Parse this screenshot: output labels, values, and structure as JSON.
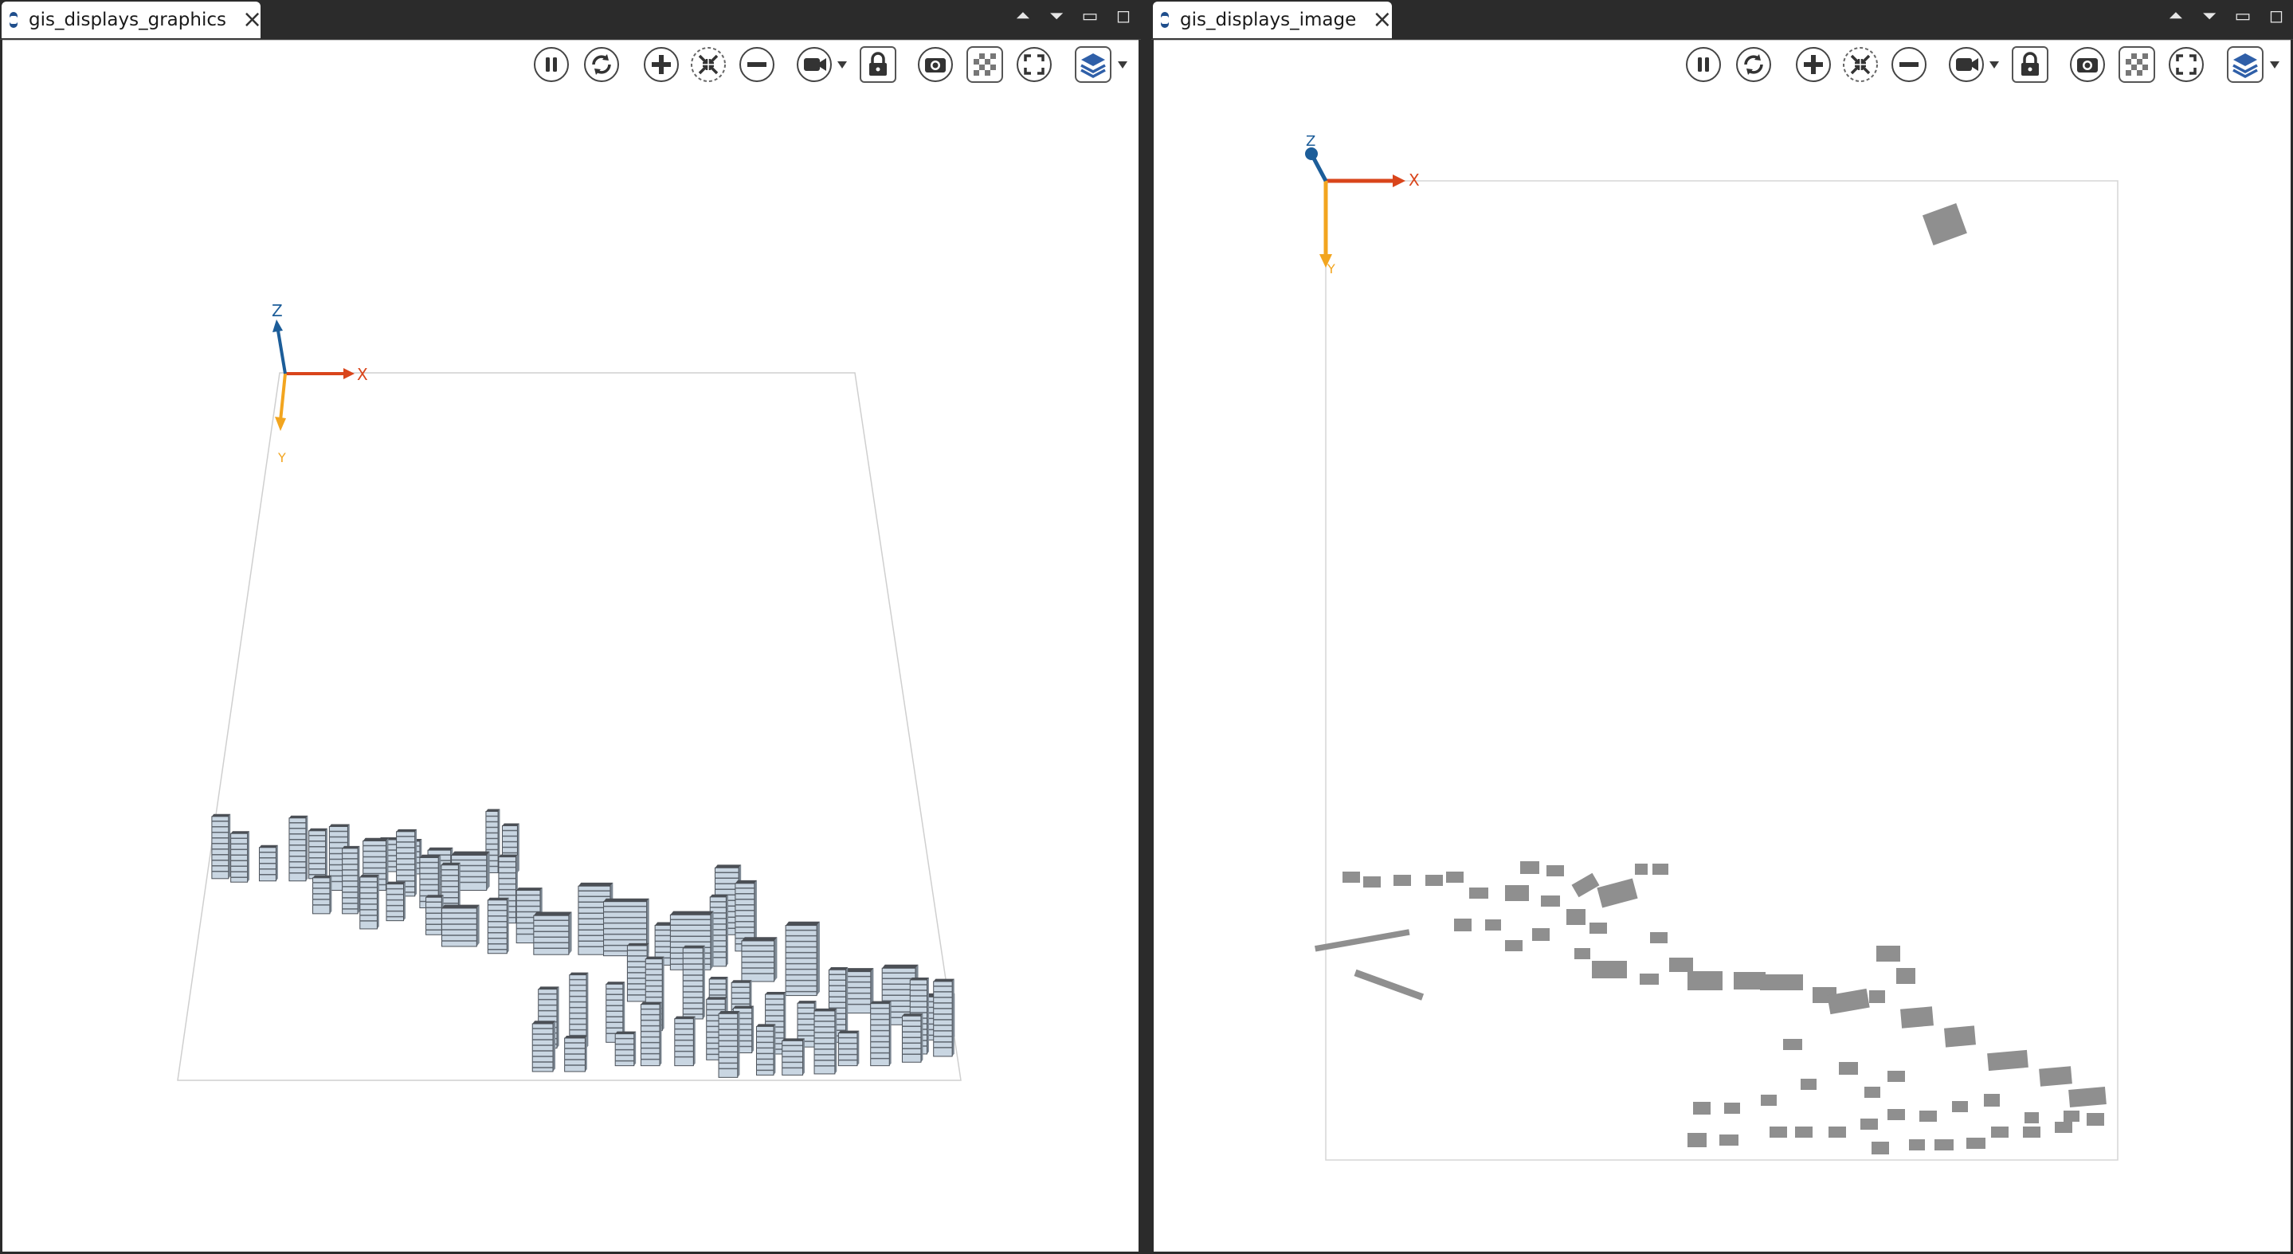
{
  "left_view": {
    "tab_title": "gis_displays_graphics",
    "axis": {
      "x": "X",
      "y": "Y",
      "z": "Z"
    }
  },
  "right_view": {
    "tab_title": "gis_displays_image",
    "axis": {
      "x": "X",
      "y": "Y",
      "z": "Z"
    }
  },
  "window_controls": [
    "restore-up-icon",
    "restore-down-icon",
    "minimize-icon",
    "maximize-icon"
  ],
  "toolbar_icons": [
    "pause-icon",
    "sync-icon",
    "zoom-in-icon",
    "zoom-fit-icon",
    "zoom-out-icon",
    "camera-icon",
    "lock-icon",
    "snapshot-icon",
    "texture-icon",
    "fullscreen-icon",
    "layers-icon"
  ],
  "colors": {
    "axis_x": "#d9451b",
    "axis_y": "#f2a51f",
    "axis_z": "#1c5d99",
    "building_fill": "#8f8f8f",
    "building_3d": "#5f6770",
    "tab_icon": "#1f4e8c"
  }
}
